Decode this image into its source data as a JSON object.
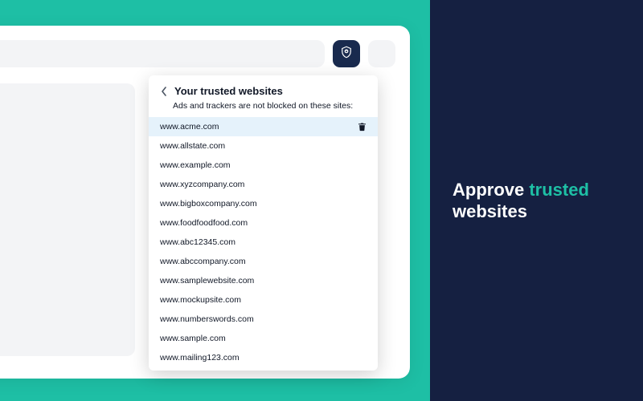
{
  "promo": {
    "line1_prefix": "Approve ",
    "line1_accent": "trusted",
    "line2": "websites"
  },
  "popup": {
    "title": "Your trusted websites",
    "subtitle": "Ads and trackers are not blocked on these sites:",
    "sites": [
      "www.acme.com",
      "www.allstate.com",
      "www.example.com",
      "www.xyzcompany.com",
      "www.bigboxcompany.com",
      "www.foodfoodfood.com",
      "www.abc12345.com",
      "www.abccompany.com",
      "www.samplewebsite.com",
      "www.mockupsite.com",
      "www.numberswords.com",
      "www.sample.com",
      "www.mailing123.com"
    ],
    "highlight_index": 0
  },
  "colors": {
    "teal": "#1EBFA5",
    "navy": "#152041",
    "ext_button": "#192A4E",
    "row_highlight": "#E5F2FB"
  }
}
